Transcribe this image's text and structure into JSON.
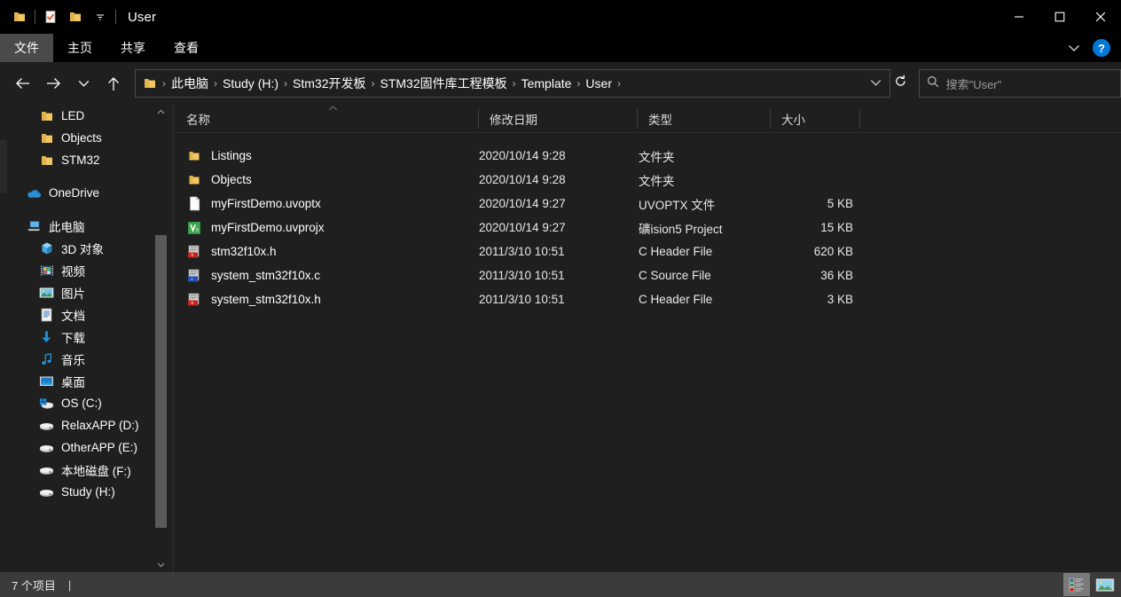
{
  "window": {
    "title": "User",
    "quick_access": [
      {
        "name": "folder-icon",
        "label": "文件资源管理器"
      },
      {
        "name": "properties-icon",
        "label": "属性"
      },
      {
        "name": "new-folder-icon",
        "label": "新建文件夹"
      },
      {
        "name": "customize-dropdown-icon",
        "label": "自定义快速访问工具栏"
      }
    ],
    "controls": {
      "minimize": "—",
      "maximize": "□",
      "close": "✕"
    }
  },
  "ribbon": {
    "tabs": [
      {
        "label": "文件",
        "active": true
      },
      {
        "label": "主页",
        "active": false
      },
      {
        "label": "共享",
        "active": false
      },
      {
        "label": "查看",
        "active": false
      }
    ],
    "collapse_icon": "chevron-down-icon",
    "help_label": "?"
  },
  "navigation": {
    "back": "←",
    "forward": "→",
    "recent": "⌄",
    "up": "↑",
    "breadcrumbs": [
      "此电脑",
      "Study (H:)",
      "Stm32开发板",
      "STM32固件库工程模板",
      "Template",
      "User"
    ],
    "dropdown_icon": "chevron-down-icon",
    "refresh_icon": "refresh-icon"
  },
  "search": {
    "icon": "search-icon",
    "placeholder": "搜索\"User\""
  },
  "sidebar": {
    "scroll_up_icon": "chevron-up-icon",
    "scroll_down_icon": "chevron-down-icon",
    "groups": [
      {
        "items": [
          {
            "label": "LED",
            "icon": "folder-icon",
            "level": 2
          },
          {
            "label": "Objects",
            "icon": "folder-icon",
            "level": 2
          },
          {
            "label": "STM32",
            "icon": "folder-icon",
            "level": 2
          }
        ]
      },
      {
        "items": [
          {
            "label": "OneDrive",
            "icon": "onedrive-cloud-icon",
            "level": 1
          }
        ]
      },
      {
        "items": [
          {
            "label": "此电脑",
            "icon": "this-pc-icon",
            "level": 1
          },
          {
            "label": "3D 对象",
            "icon": "3d-objects-icon",
            "level": 2
          },
          {
            "label": "视频",
            "icon": "videos-icon",
            "level": 2
          },
          {
            "label": "图片",
            "icon": "pictures-icon",
            "level": 2
          },
          {
            "label": "文档",
            "icon": "documents-icon",
            "level": 2
          },
          {
            "label": "下载",
            "icon": "downloads-icon",
            "level": 2
          },
          {
            "label": "音乐",
            "icon": "music-icon",
            "level": 2
          },
          {
            "label": "桌面",
            "icon": "desktop-icon",
            "level": 2
          },
          {
            "label": "OS (C:)",
            "icon": "windows-drive-icon",
            "level": 2
          },
          {
            "label": "RelaxAPP (D:)",
            "icon": "drive-icon",
            "level": 2
          },
          {
            "label": "OtherAPP (E:)",
            "icon": "drive-icon",
            "level": 2
          },
          {
            "label": "本地磁盘 (F:)",
            "icon": "drive-icon",
            "level": 2
          },
          {
            "label": "Study (H:)",
            "icon": "drive-icon",
            "level": 2
          }
        ]
      }
    ]
  },
  "file_list": {
    "columns": [
      {
        "label": "名称",
        "sorted": "asc"
      },
      {
        "label": "修改日期",
        "sorted": ""
      },
      {
        "label": "类型",
        "sorted": ""
      },
      {
        "label": "大小",
        "sorted": ""
      }
    ],
    "rows": [
      {
        "name": "Listings",
        "date": "2020/10/14 9:28",
        "type": "文件夹",
        "size": "",
        "icon": "folder-icon"
      },
      {
        "name": "Objects",
        "date": "2020/10/14 9:28",
        "type": "文件夹",
        "size": "",
        "icon": "folder-icon"
      },
      {
        "name": "myFirstDemo.uvoptx",
        "date": "2020/10/14 9:27",
        "type": "UVOPTX 文件",
        "size": "5 KB",
        "icon": "generic-file-icon"
      },
      {
        "name": "myFirstDemo.uvprojx",
        "date": "2020/10/14 9:27",
        "type": "礦ision5 Project",
        "size": "15 KB",
        "icon": "uvision-project-icon"
      },
      {
        "name": "stm32f10x.h",
        "date": "2011/3/10 10:51",
        "type": "C Header File",
        "size": "620 KB",
        "icon": "c-header-file-icon"
      },
      {
        "name": "system_stm32f10x.c",
        "date": "2011/3/10 10:51",
        "type": "C Source File",
        "size": "36 KB",
        "icon": "c-source-file-icon"
      },
      {
        "name": "system_stm32f10x.h",
        "date": "2011/3/10 10:51",
        "type": "C Header File",
        "size": "3 KB",
        "icon": "c-header-file-icon"
      }
    ]
  },
  "status_bar": {
    "item_count": "7 个项目",
    "separator": "|",
    "views": [
      {
        "name": "details-view-button",
        "selected": true
      },
      {
        "name": "large-icons-view-button",
        "selected": false
      }
    ]
  },
  "colors": {
    "background": "#1f1f1f",
    "titlebar": "#000000",
    "accent": "#0078d7",
    "folder_yellow": "#f7cc6a",
    "status_bar": "#3b3b3b",
    "text": "#ffffff"
  }
}
